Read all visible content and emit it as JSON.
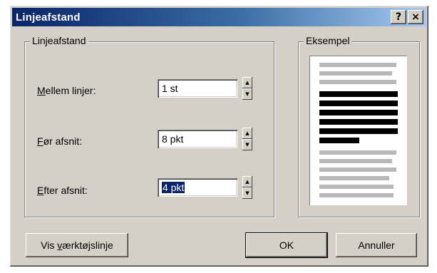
{
  "window": {
    "title": "Linjeafstand",
    "help_label": "?",
    "close_label": "×"
  },
  "spacing_group": {
    "legend": "Linjeafstand",
    "rows": [
      {
        "label_access": "M",
        "label_rest": "ellem linjer:",
        "value": "1 st"
      },
      {
        "label_access": "F",
        "label_rest": "ør afsnit:",
        "value": "8 pkt"
      },
      {
        "label_access": "E",
        "label_rest": "fter afsnit:",
        "value": "4 pkt"
      }
    ]
  },
  "example_group": {
    "legend": "Eksempel"
  },
  "buttons": {
    "toolbar_pre": "Vis ",
    "toolbar_access": "v",
    "toolbar_post": "ærktøjslinje",
    "ok": "OK",
    "cancel": "Annuller"
  },
  "colors": {
    "face": "#d4d0c8",
    "title_start": "#0a246a",
    "selection": "#0a246a"
  }
}
